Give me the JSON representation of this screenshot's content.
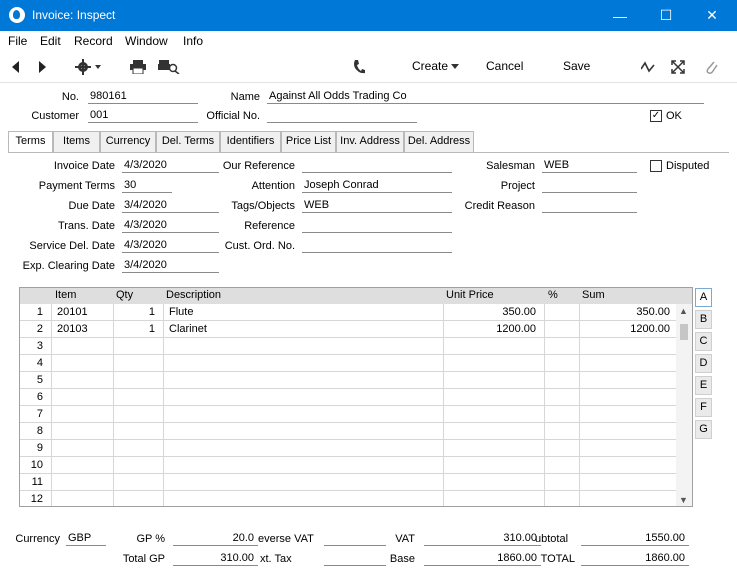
{
  "window": {
    "title": "Invoice: Inspect",
    "minimize": "—",
    "maximize": "☐",
    "close": "✕"
  },
  "menu": [
    "File",
    "Edit",
    "Record",
    "Window",
    "Info"
  ],
  "toolbar": {
    "create": "Create",
    "cancel": "Cancel",
    "save": "Save"
  },
  "header": {
    "no_label": "No.",
    "no_value": "980161",
    "name_label": "Name",
    "name_value": "Against All Odds Trading Co",
    "customer_label": "Customer",
    "customer_value": "001",
    "official_label": "Official No.",
    "official_value": "",
    "ok_label": "OK",
    "ok_checked": true
  },
  "tabs": [
    "Terms",
    "Items",
    "Currency",
    "Del. Terms",
    "Identifiers",
    "Price List",
    "Inv. Address",
    "Del. Address"
  ],
  "terms": {
    "invoice_date_label": "Invoice Date",
    "invoice_date": "4/3/2020",
    "payment_terms_label": "Payment Terms",
    "payment_terms": "30",
    "due_date_label": "Due Date",
    "due_date": "3/4/2020",
    "trans_date_label": "Trans. Date",
    "trans_date": "4/3/2020",
    "service_del_date_label": "Service Del. Date",
    "service_del_date": "4/3/2020",
    "exp_clearing_date_label": "Exp. Clearing Date",
    "exp_clearing_date": "3/4/2020",
    "our_reference_label": "Our Reference",
    "our_reference": "",
    "attention_label": "Attention",
    "attention": "Joseph Conrad",
    "tags_label": "Tags/Objects",
    "tags": "WEB",
    "reference_label": "Reference",
    "reference": "",
    "cust_ord_label": "Cust. Ord. No.",
    "cust_ord": "",
    "salesman_label": "Salesman",
    "salesman": "WEB",
    "project_label": "Project",
    "project": "",
    "credit_reason_label": "Credit Reason",
    "credit_reason": "",
    "disputed_label": "Disputed",
    "disputed_checked": false
  },
  "grid": {
    "columns": [
      "Item",
      "Qty",
      "Description",
      "Unit Price",
      "%",
      "Sum"
    ],
    "rows": [
      {
        "n": "1",
        "item": "20101",
        "qty": "1",
        "desc": "Flute",
        "price": "350.00",
        "pct": "",
        "sum": "350.00"
      },
      {
        "n": "2",
        "item": "20103",
        "qty": "1",
        "desc": "Clarinet",
        "price": "1200.00",
        "pct": "",
        "sum": "1200.00"
      },
      {
        "n": "3",
        "item": "",
        "qty": "",
        "desc": "",
        "price": "",
        "pct": "",
        "sum": ""
      },
      {
        "n": "4",
        "item": "",
        "qty": "",
        "desc": "",
        "price": "",
        "pct": "",
        "sum": ""
      },
      {
        "n": "5",
        "item": "",
        "qty": "",
        "desc": "",
        "price": "",
        "pct": "",
        "sum": ""
      },
      {
        "n": "6",
        "item": "",
        "qty": "",
        "desc": "",
        "price": "",
        "pct": "",
        "sum": ""
      },
      {
        "n": "7",
        "item": "",
        "qty": "",
        "desc": "",
        "price": "",
        "pct": "",
        "sum": ""
      },
      {
        "n": "8",
        "item": "",
        "qty": "",
        "desc": "",
        "price": "",
        "pct": "",
        "sum": ""
      },
      {
        "n": "9",
        "item": "",
        "qty": "",
        "desc": "",
        "price": "",
        "pct": "",
        "sum": ""
      },
      {
        "n": "10",
        "item": "",
        "qty": "",
        "desc": "",
        "price": "",
        "pct": "",
        "sum": ""
      },
      {
        "n": "11",
        "item": "",
        "qty": "",
        "desc": "",
        "price": "",
        "pct": "",
        "sum": ""
      },
      {
        "n": "12",
        "item": "",
        "qty": "",
        "desc": "",
        "price": "",
        "pct": "",
        "sum": ""
      }
    ],
    "side_tabs": [
      "A",
      "B",
      "C",
      "D",
      "E",
      "F",
      "G"
    ]
  },
  "footer": {
    "currency_label": "Currency",
    "currency": "GBP",
    "gp_pct_label": "GP %",
    "gp_pct": "20.0",
    "reverse_vat_label": "everse VAT",
    "reverse_vat": "",
    "vat_label": "VAT",
    "vat": "310.00",
    "subtotal_label": "ubtotal",
    "subtotal": "1550.00",
    "total_gp_label": "Total GP",
    "total_gp": "310.00",
    "ext_tax_label": "xt. Tax",
    "ext_tax": "",
    "base_label": "Base",
    "base": "1860.00",
    "total_label": "TOTAL",
    "total": "1860.00"
  },
  "colors": {
    "titlebar": "#0078d7",
    "grid_header": "#dedede",
    "side_tab_active_border": "#79a9d6"
  }
}
